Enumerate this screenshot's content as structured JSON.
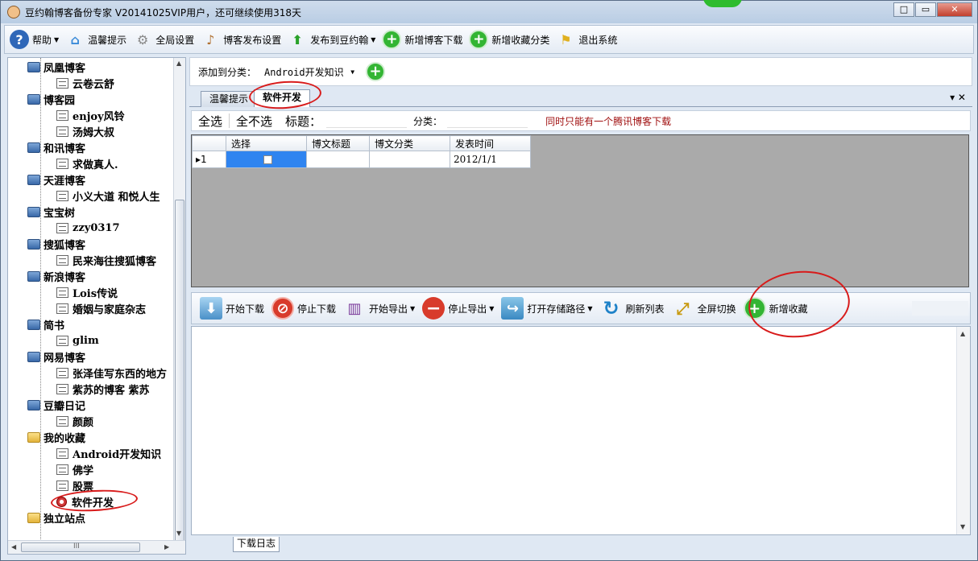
{
  "window": {
    "title": "豆约翰博客备份专家 V20141025VIP用户，还可继续使用318天",
    "buttons": [
      "□",
      "▭",
      "✕"
    ]
  },
  "toolbar": {
    "items": [
      {
        "label": "帮助",
        "icon": "help-icon",
        "dropdown": true
      },
      {
        "label": "温馨提示",
        "icon": "home-icon"
      },
      {
        "label": "全局设置",
        "icon": "gear-icon"
      },
      {
        "label": "博客发布设置",
        "icon": "guitar-icon"
      },
      {
        "label": "发布到豆约翰",
        "icon": "up-arrow-icon",
        "dropdown": true
      },
      {
        "label": "新增博客下载",
        "icon": "plus-icon"
      },
      {
        "label": "新增收藏分类",
        "icon": "plus-icon"
      },
      {
        "label": "退出系统",
        "icon": "flag-icon"
      }
    ]
  },
  "tree": {
    "nodes": [
      {
        "type": "cat",
        "label": "凤凰博客"
      },
      {
        "type": "leaf",
        "label": "云卷云舒"
      },
      {
        "type": "cat",
        "label": "博客园"
      },
      {
        "type": "leaf",
        "label": "enjoy风铃"
      },
      {
        "type": "leaf",
        "label": "汤姆大叔"
      },
      {
        "type": "cat",
        "label": "和讯博客"
      },
      {
        "type": "leaf",
        "label": "求做真人."
      },
      {
        "type": "cat",
        "label": "天涯博客"
      },
      {
        "type": "leaf",
        "label": "小义大道 和悦人生"
      },
      {
        "type": "cat",
        "label": "宝宝树"
      },
      {
        "type": "leaf",
        "label": "zzy0317"
      },
      {
        "type": "cat",
        "label": "搜狐博客"
      },
      {
        "type": "leaf",
        "label": "民来海往搜狐博客"
      },
      {
        "type": "cat",
        "label": "新浪博客"
      },
      {
        "type": "leaf",
        "label": "Lois传说"
      },
      {
        "type": "leaf",
        "label": "婚姻与家庭杂志"
      },
      {
        "type": "cat",
        "label": "简书"
      },
      {
        "type": "leaf",
        "label": "glim"
      },
      {
        "type": "cat",
        "label": "网易博客"
      },
      {
        "type": "leaf",
        "label": "张泽佳写东西的地方"
      },
      {
        "type": "leaf",
        "label": "紫苏的博客  紫苏"
      },
      {
        "type": "cat",
        "label": "豆瓣日记"
      },
      {
        "type": "leaf",
        "label": "颜颜"
      },
      {
        "type": "fav",
        "label": "我的收藏"
      },
      {
        "type": "leaf",
        "label": "Android开发知识"
      },
      {
        "type": "leaf",
        "label": "佛学"
      },
      {
        "type": "leaf",
        "label": "股票"
      },
      {
        "type": "leafsel",
        "label": "软件开发"
      },
      {
        "type": "fav",
        "label": "独立站点"
      }
    ],
    "hscroll_label": "III"
  },
  "addbar": {
    "label": "添加到分类：",
    "selected": "Android开发知识"
  },
  "tabs": [
    {
      "label": "温馨提示"
    },
    {
      "label": "软件开发",
      "active": true
    }
  ],
  "tab_tools": "▾ ✕",
  "filter": {
    "select_all": "全选",
    "select_none": "全不选",
    "title_label": "标题：",
    "category_label": "分类：",
    "warning": "同时只能有一个腾讯博客下载"
  },
  "grid": {
    "columns": [
      "选择",
      "博文标题",
      "博文分类",
      "发表时间"
    ],
    "rows": [
      {
        "index": "▸1",
        "checked": false,
        "title": "",
        "category": "",
        "date": "2012/1/1"
      }
    ]
  },
  "toolbar2": {
    "items": [
      {
        "label": "开始下载",
        "icon": "download-icon"
      },
      {
        "label": "停止下载",
        "icon": "stop-icon"
      },
      {
        "label": "开始导出",
        "icon": "books-icon",
        "dropdown": true
      },
      {
        "label": "停止导出",
        "icon": "minus-icon",
        "dropdown": true
      },
      {
        "label": "打开存储路径",
        "icon": "folder-icon",
        "dropdown": true
      },
      {
        "label": "刷新列表",
        "icon": "refresh-icon"
      },
      {
        "label": "全屏切换",
        "icon": "fullscreen-icon"
      },
      {
        "label": "新增收藏",
        "icon": "plus-icon"
      }
    ]
  },
  "bottom_tab": "下载日志"
}
